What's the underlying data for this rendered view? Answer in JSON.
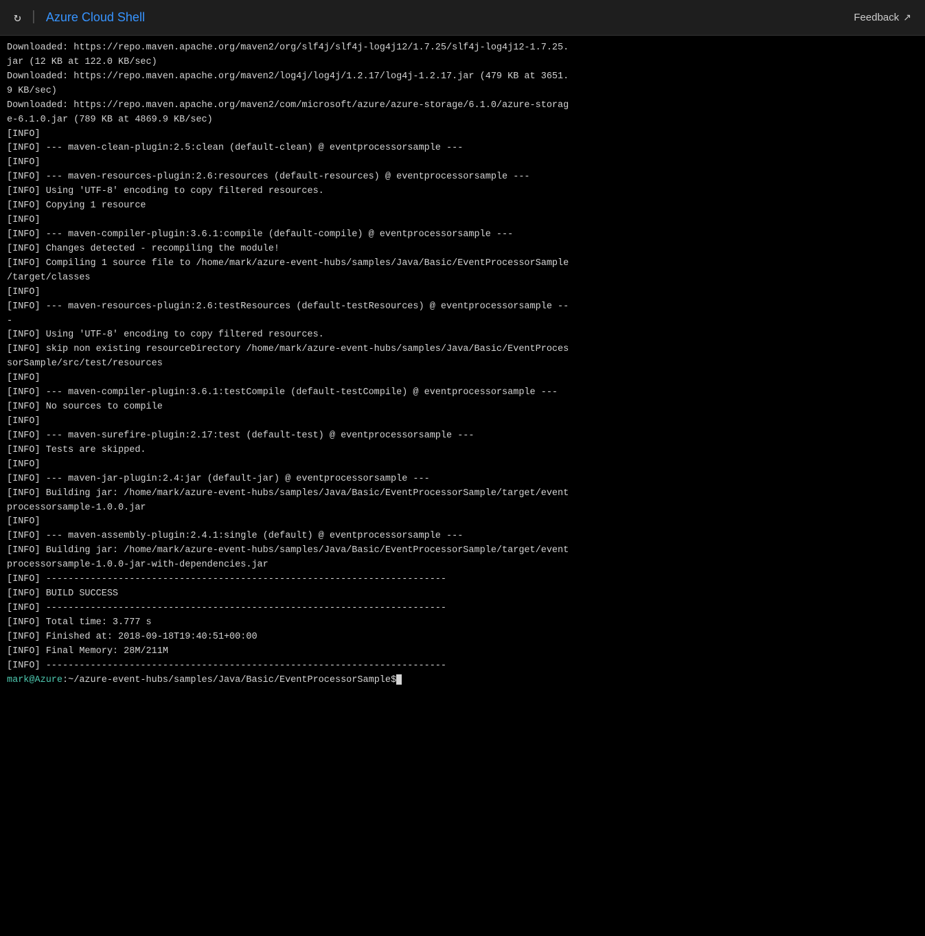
{
  "titlebar": {
    "app_title": "Azure Cloud Shell",
    "refresh_icon": "↻",
    "divider": "|",
    "feedback_label": "Feedback",
    "feedback_icon": "↗"
  },
  "terminal": {
    "lines": [
      "Downloaded: https://repo.maven.apache.org/maven2/org/slf4j/slf4j-log4j12/1.7.25/slf4j-log4j12-1.7.25.",
      "jar (12 KB at 122.0 KB/sec)",
      "Downloaded: https://repo.maven.apache.org/maven2/log4j/log4j/1.2.17/log4j-1.2.17.jar (479 KB at 3651.",
      "9 KB/sec)",
      "Downloaded: https://repo.maven.apache.org/maven2/com/microsoft/azure/azure-storage/6.1.0/azure-storag",
      "e-6.1.0.jar (789 KB at 4869.9 KB/sec)",
      "[INFO]",
      "[INFO] --- maven-clean-plugin:2.5:clean (default-clean) @ eventprocessorsample ---",
      "[INFO]",
      "[INFO] --- maven-resources-plugin:2.6:resources (default-resources) @ eventprocessorsample ---",
      "[INFO] Using 'UTF-8' encoding to copy filtered resources.",
      "[INFO] Copying 1 resource",
      "[INFO]",
      "[INFO] --- maven-compiler-plugin:3.6.1:compile (default-compile) @ eventprocessorsample ---",
      "[INFO] Changes detected - recompiling the module!",
      "[INFO] Compiling 1 source file to /home/mark/azure-event-hubs/samples/Java/Basic/EventProcessorSample",
      "/target/classes",
      "[INFO]",
      "[INFO] --- maven-resources-plugin:2.6:testResources (default-testResources) @ eventprocessorsample --",
      "-",
      "[INFO] Using 'UTF-8' encoding to copy filtered resources.",
      "[INFO] skip non existing resourceDirectory /home/mark/azure-event-hubs/samples/Java/Basic/EventProces",
      "sorSample/src/test/resources",
      "[INFO]",
      "[INFO] --- maven-compiler-plugin:3.6.1:testCompile (default-testCompile) @ eventprocessorsample ---",
      "[INFO] No sources to compile",
      "[INFO]",
      "[INFO] --- maven-surefire-plugin:2.17:test (default-test) @ eventprocessorsample ---",
      "[INFO] Tests are skipped.",
      "[INFO]",
      "[INFO] --- maven-jar-plugin:2.4:jar (default-jar) @ eventprocessorsample ---",
      "[INFO] Building jar: /home/mark/azure-event-hubs/samples/Java/Basic/EventProcessorSample/target/event",
      "processorsample-1.0.0.jar",
      "[INFO]",
      "[INFO] --- maven-assembly-plugin:2.4.1:single (default) @ eventprocessorsample ---",
      "[INFO] Building jar: /home/mark/azure-event-hubs/samples/Java/Basic/EventProcessorSample/target/event",
      "processorsample-1.0.0-jar-with-dependencies.jar",
      "[INFO] ------------------------------------------------------------------------",
      "[INFO] BUILD SUCCESS",
      "[INFO] ------------------------------------------------------------------------",
      "[INFO] Total time: 3.777 s",
      "[INFO] Finished at: 2018-09-18T19:40:51+00:00",
      "[INFO] Final Memory: 28M/211M",
      "[INFO] ------------------------------------------------------------------------"
    ],
    "prompt_user": "mark@Azure",
    "prompt_path": ":~/azure-event-hubs/samples/Java/Basic/EventProcessorSample",
    "prompt_dollar": "$"
  }
}
